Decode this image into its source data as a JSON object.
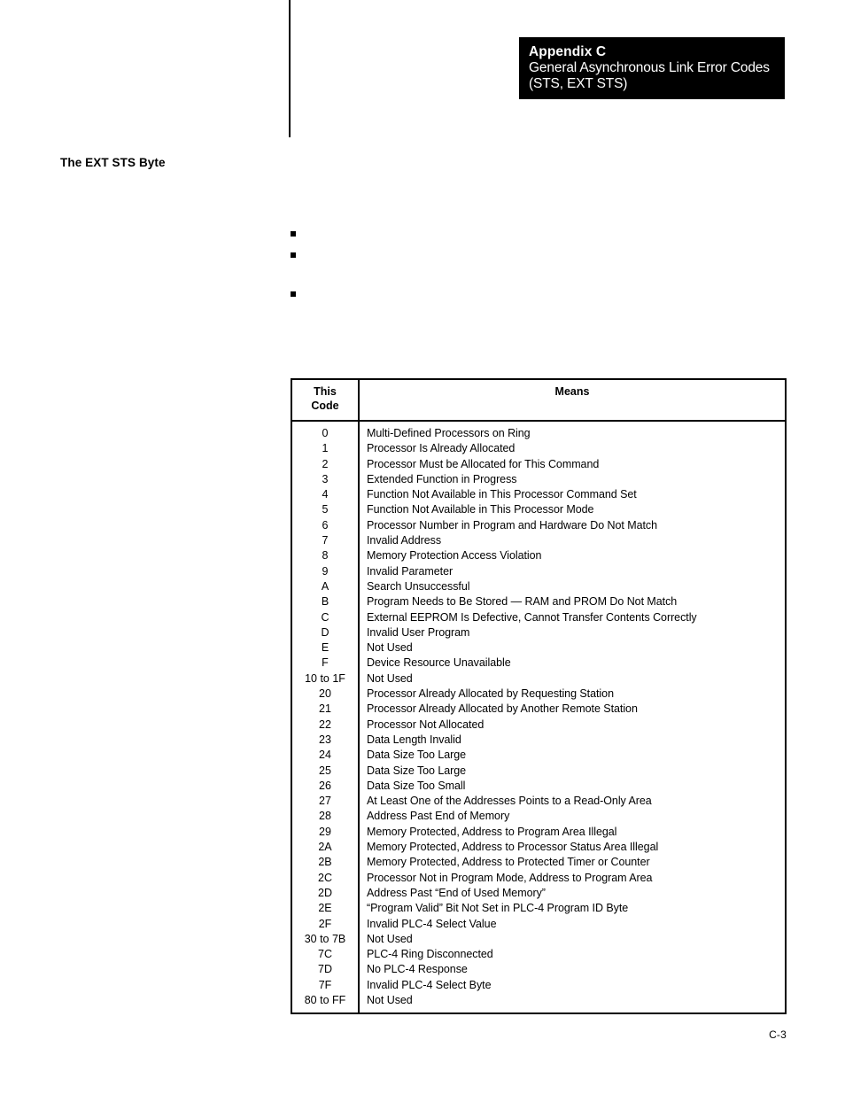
{
  "banner": {
    "appendix_label": "Appendix C",
    "title": "General Asynchronous Link Error Codes",
    "subtitle": "(STS, EXT STS)"
  },
  "section": {
    "heading": "The EXT STS Byte"
  },
  "bullets": [
    {
      "marker": "square-bullet",
      "text": ""
    },
    {
      "marker": "square-bullet",
      "text": ""
    },
    {
      "marker": "square-bullet",
      "text": ""
    }
  ],
  "table": {
    "headers": {
      "code_line1": "This",
      "code_line2": "Code",
      "means": "Means"
    },
    "rows": [
      {
        "code": "0",
        "means": "Multi-Defined Processors on Ring"
      },
      {
        "code": "1",
        "means": "Processor Is Already Allocated"
      },
      {
        "code": "2",
        "means": "Processor Must be Allocated for This Command"
      },
      {
        "code": "3",
        "means": "Extended Function in Progress"
      },
      {
        "code": "4",
        "means": "Function Not Available in This Processor Command Set"
      },
      {
        "code": "5",
        "means": "Function Not Available in This Processor Mode"
      },
      {
        "code": "6",
        "means": "Processor Number in Program and  Hardware Do Not Match"
      },
      {
        "code": "7",
        "means": "Invalid Address"
      },
      {
        "code": "8",
        "means": "Memory Protection Access Violation"
      },
      {
        "code": "9",
        "means": "Invalid Parameter"
      },
      {
        "code": "A",
        "means": "Search Unsuccessful"
      },
      {
        "code": "B",
        "means": "Program Needs to Be Stored  —  RAM and PROM Do Not Match"
      },
      {
        "code": "C",
        "means": "External EEPROM Is Defective, Cannot Transfer Contents Correctly"
      },
      {
        "code": "D",
        "means": "Invalid User Program"
      },
      {
        "code": "E",
        "means": "Not Used"
      },
      {
        "code": "F",
        "means": "Device Resource Unavailable"
      },
      {
        "code": "10 to 1F",
        "means": "Not Used"
      },
      {
        "code": "20",
        "means": "Processor Already Allocated by Requesting Station"
      },
      {
        "code": "21",
        "means": "Processor Already Allocated by Another Remote Station"
      },
      {
        "code": "22",
        "means": "Processor Not Allocated"
      },
      {
        "code": "23",
        "means": "Data Length Invalid"
      },
      {
        "code": "24",
        "means": "Data Size Too Large"
      },
      {
        "code": "25",
        "means": "Data Size Too Large"
      },
      {
        "code": "26",
        "means": "Data Size Too Small"
      },
      {
        "code": "27",
        "means": "At Least One of the Addresses Points to a Read-Only Area"
      },
      {
        "code": "28",
        "means": "Address Past End of Memory"
      },
      {
        "code": "29",
        "means": "Memory Protected, Address to Program Area Illegal"
      },
      {
        "code": "2A",
        "means": "Memory Protected, Address to Processor Status Area Illegal"
      },
      {
        "code": "2B",
        "means": "Memory Protected, Address to Protected Timer or Counter"
      },
      {
        "code": "2C",
        "means": "Processor Not in Program Mode, Address to Program Area"
      },
      {
        "code": "2D",
        "means": "Address Past “End of Used Memory”"
      },
      {
        "code": "2E",
        "means": "“Program Valid” Bit Not Set in PLC-4 Program ID Byte"
      },
      {
        "code": "2F",
        "means": "Invalid PLC-4 Select Value"
      },
      {
        "code": "30 to 7B",
        "means": "Not Used"
      },
      {
        "code": "7C",
        "means": "PLC-4 Ring Disconnected"
      },
      {
        "code": "7D",
        "means": "No PLC-4 Response"
      },
      {
        "code": "7F",
        "means": "Invalid PLC-4 Select Byte"
      },
      {
        "code": "80 to FF",
        "means": "Not Used"
      }
    ]
  },
  "footer": {
    "page_number": "C-3"
  }
}
